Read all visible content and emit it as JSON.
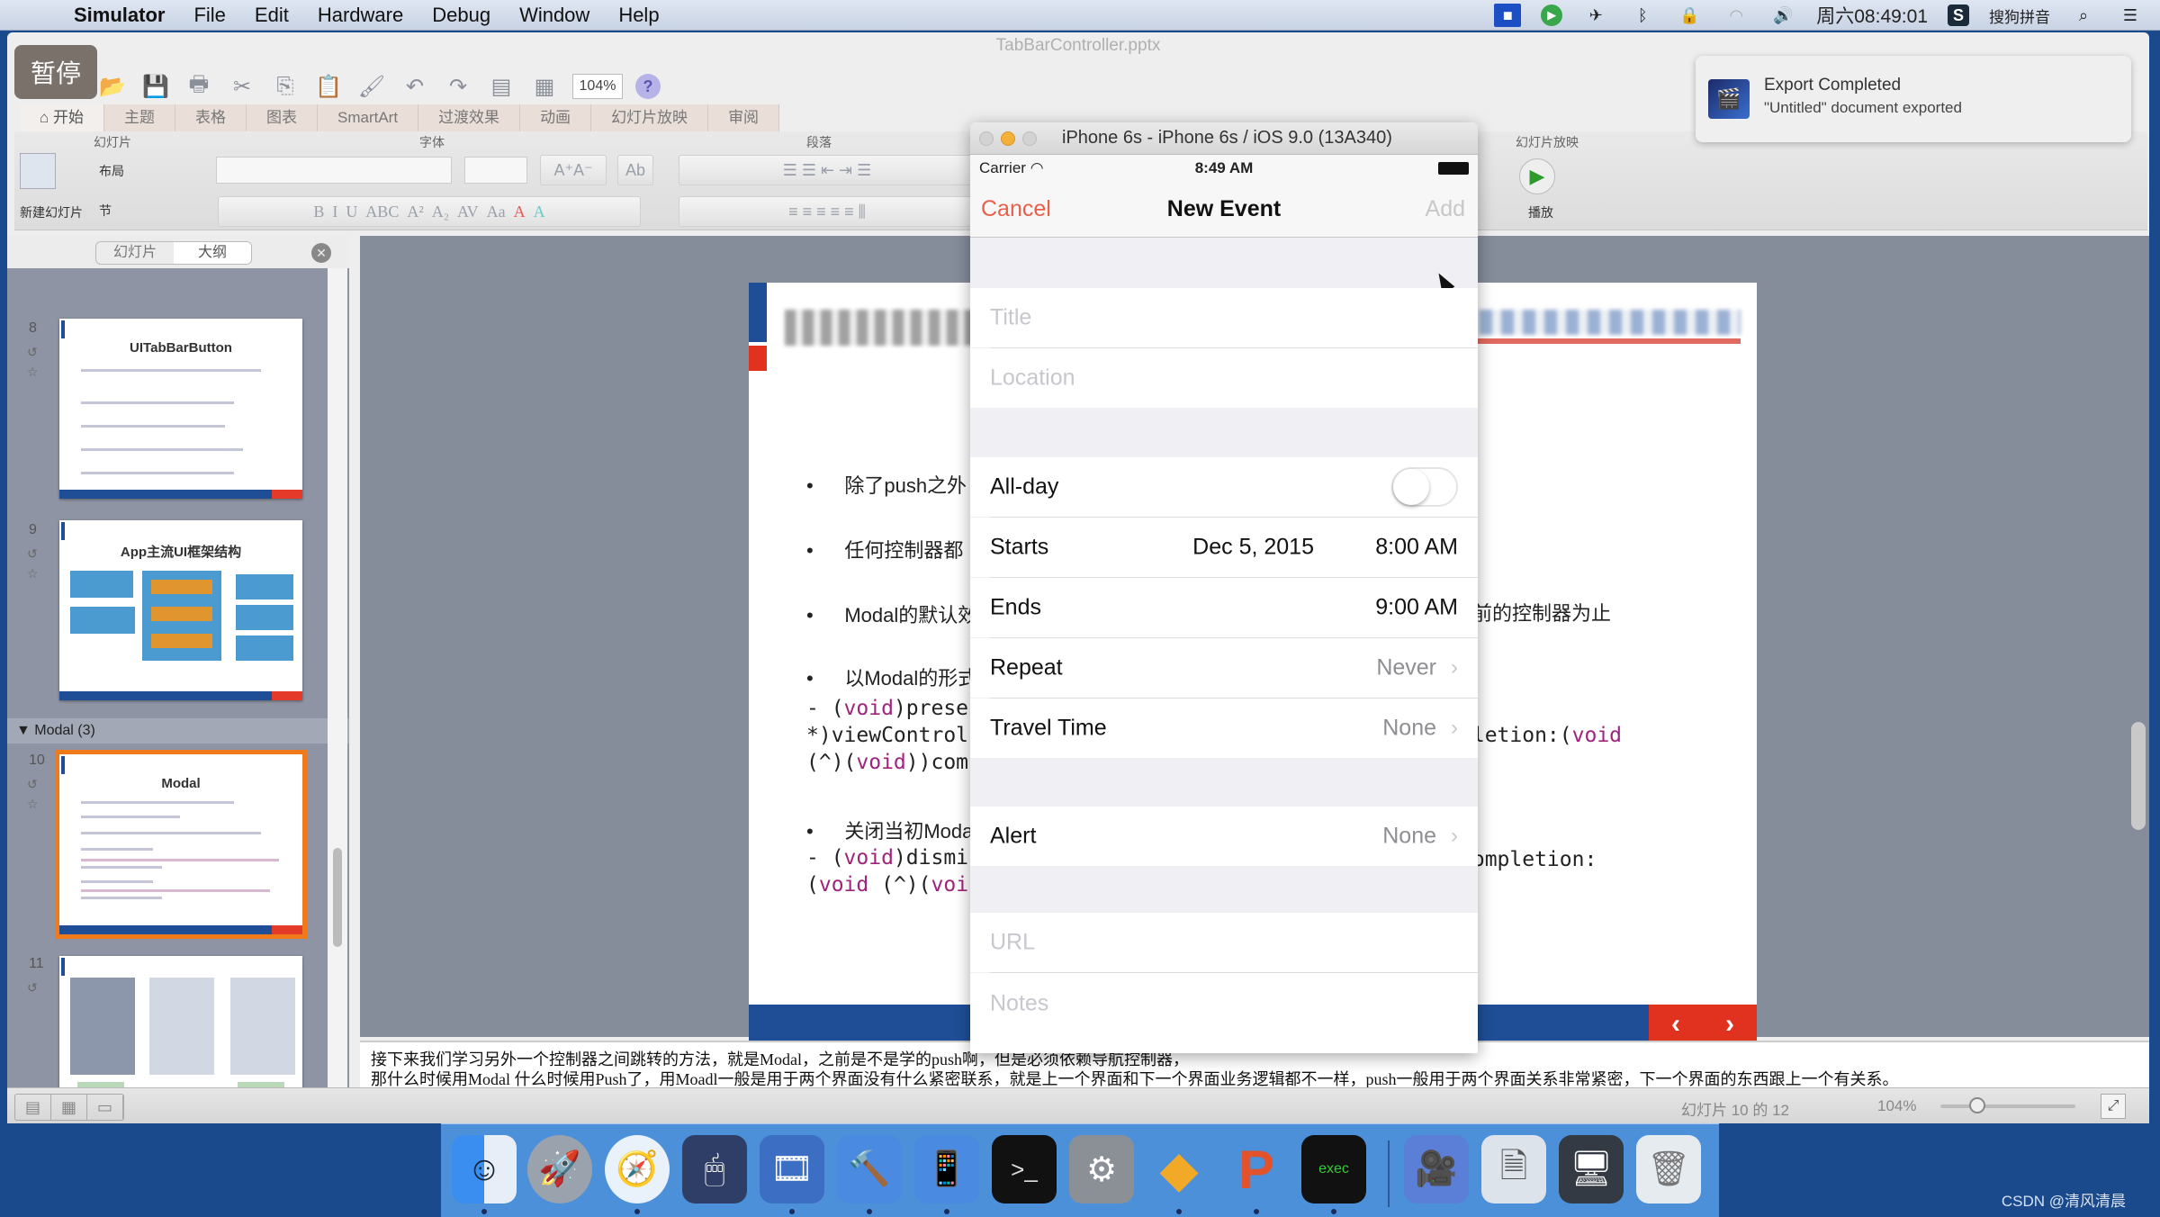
{
  "menubar": {
    "app": "Simulator",
    "items": [
      "File",
      "Edit",
      "Hardware",
      "Debug",
      "Window",
      "Help"
    ],
    "clock": "周六08:49:01",
    "input_method": "搜狗拼音"
  },
  "ppt": {
    "doc_title": "TabBarController.pptx",
    "pause_label": "暂停",
    "zoom": "104%",
    "tabs": [
      "开始",
      "主题",
      "表格",
      "图表",
      "SmartArt",
      "过渡效果",
      "动画",
      "幻灯片放映",
      "审阅"
    ],
    "groups": {
      "slides": "幻灯片",
      "font": "字体",
      "paragraph": "段落",
      "slideshow": "幻灯片放映"
    },
    "buttons": {
      "new_slide": "新建幻灯片",
      "layout": "布局",
      "section": "节",
      "play": "播放"
    },
    "panel_tabs": [
      "幻灯片",
      "大纲"
    ],
    "thumbnails": [
      {
        "num": "8",
        "title": "UITabBarButton"
      },
      {
        "num": "9",
        "title": "App主流UI框架结构"
      },
      {
        "num": "10",
        "title": "Modal",
        "selected": true
      },
      {
        "num": "11",
        "title": ""
      }
    ],
    "section_label": "Modal (3)",
    "slide": {
      "bullets": [
        "除了push之外",
        "任何控制器都",
        "Modal的默认效",
        "以Modal的形式",
        "关闭当初Moda"
      ],
      "right_text_1": "前的控制器为止",
      "code1": [
        "- (void)prese",
        "*)viewControl",
        "(^)(void))com"
      ],
      "code1_right": "pletion:(void",
      "code2": [
        "- (void)dismi",
        "(void (^)(voi"
      ],
      "code2_right": "completion:"
    },
    "notes": [
      "接下来我们学习另外一个控制器之间跳转的方法，就是Modal，之前是不是学的push啊，但是必须依赖导航控制器，",
      "那什么时候用Modal 什么时候用Push了，用Moadl一般是用于两个界面没有什么紧密联系，就是上一个界面和下一个界面业务逻辑都不一样，push一般用于两个界面关系非常紧密，下一个界面的东西跟上一个有关系。"
    ],
    "status": {
      "slide_count": "幻灯片 10 的 12",
      "zoom": "104%",
      "zoom_level_percent": 104
    }
  },
  "notification": {
    "title": "Export Completed",
    "body": "\"Untitled\" document exported"
  },
  "simulator": {
    "window_title": "iPhone 6s - iPhone 6s / iOS 9.0 (13A340)",
    "status": {
      "carrier": "Carrier",
      "time": "8:49 AM"
    },
    "nav": {
      "cancel": "Cancel",
      "title": "New Event",
      "add": "Add"
    },
    "fields": {
      "title_placeholder": "Title",
      "location_placeholder": "Location",
      "allday_label": "All-day",
      "allday_on": false,
      "starts_label": "Starts",
      "starts_date": "Dec 5, 2015",
      "starts_time": "8:00 AM",
      "ends_label": "Ends",
      "ends_time": "9:00 AM",
      "repeat_label": "Repeat",
      "repeat_value": "Never",
      "travel_label": "Travel Time",
      "travel_value": "None",
      "alert_label": "Alert",
      "alert_value": "None",
      "url_placeholder": "URL",
      "notes_placeholder": "Notes"
    }
  },
  "dock": {
    "apps": [
      "Finder",
      "Launchpad",
      "Safari",
      "Mouse",
      "Screen Recorder",
      "Xcode",
      "Simulator",
      "Terminal",
      "System Preferences",
      "Sketch",
      "PowerPoint",
      "Console",
      "Presentation",
      "Document",
      "Screen",
      "Trash"
    ]
  },
  "watermark": "CSDN @清风清晨"
}
